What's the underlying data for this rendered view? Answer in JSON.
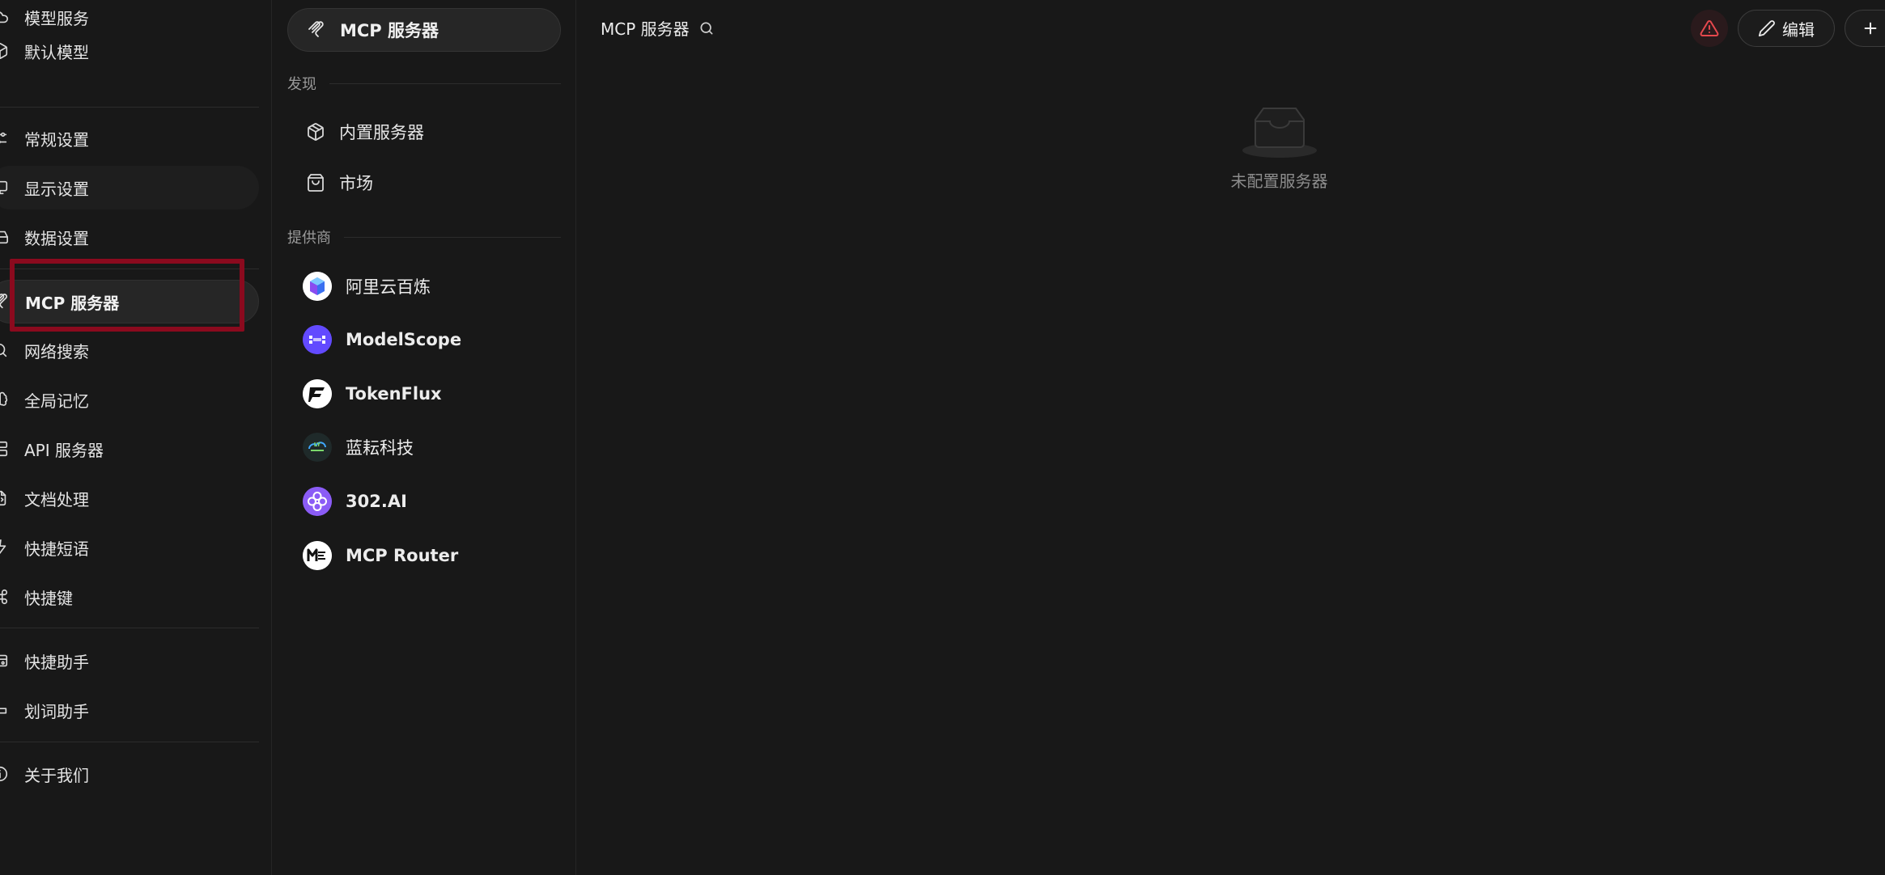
{
  "nav": {
    "items": [
      {
        "id": "model-service",
        "label": "模型服务",
        "icon": "cloud-icon"
      },
      {
        "id": "default-model",
        "label": "默认模型",
        "icon": "cube-icon"
      },
      {
        "id": "general-settings",
        "label": "常规设置",
        "icon": "sliders-icon"
      },
      {
        "id": "display-settings",
        "label": "显示设置",
        "icon": "monitor-icon"
      },
      {
        "id": "data-settings",
        "label": "数据设置",
        "icon": "database-icon"
      },
      {
        "id": "mcp-servers",
        "label": "MCP 服务器",
        "icon": "mcp-icon",
        "active": true
      },
      {
        "id": "web-search",
        "label": "网络搜索",
        "icon": "search-icon"
      },
      {
        "id": "global-memory",
        "label": "全局记忆",
        "icon": "brain-icon"
      },
      {
        "id": "api-server",
        "label": "API 服务器",
        "icon": "server-icon"
      },
      {
        "id": "doc-processing",
        "label": "文档处理",
        "icon": "file-code-icon"
      },
      {
        "id": "quick-phrases",
        "label": "快捷短语",
        "icon": "zap-icon"
      },
      {
        "id": "shortcuts",
        "label": "快捷键",
        "icon": "command-icon"
      },
      {
        "id": "quick-assistant",
        "label": "快捷助手",
        "icon": "app-window-icon"
      },
      {
        "id": "selection-assistant",
        "label": "划词助手",
        "icon": "text-cursor-icon"
      },
      {
        "id": "about",
        "label": "关于我们",
        "icon": "info-icon"
      }
    ]
  },
  "mid": {
    "header_label": "MCP 服务器",
    "discover_title": "发现",
    "discover_items": [
      {
        "label": "内置服务器",
        "icon": "package-icon"
      },
      {
        "label": "市场",
        "icon": "shopping-bag-icon"
      }
    ],
    "providers_title": "提供商",
    "providers": [
      {
        "name": "阿里云百炼",
        "logo": "bailian-logo"
      },
      {
        "name": "ModelScope",
        "logo": "modelscope-logo"
      },
      {
        "name": "TokenFlux",
        "logo": "tokenflux-logo"
      },
      {
        "name": "蓝耘科技",
        "logo": "lanyun-logo"
      },
      {
        "name": "302.AI",
        "logo": "302ai-logo"
      },
      {
        "name": "MCP Router",
        "logo": "mcprouter-logo"
      }
    ]
  },
  "main": {
    "title": "MCP 服务器",
    "edit_label": "编辑",
    "empty_text": "未配置服务器"
  },
  "colors": {
    "background": "#181818",
    "active_item": "#262626",
    "highlight_border": "#8b0a1e",
    "warning": "#e5484d"
  }
}
